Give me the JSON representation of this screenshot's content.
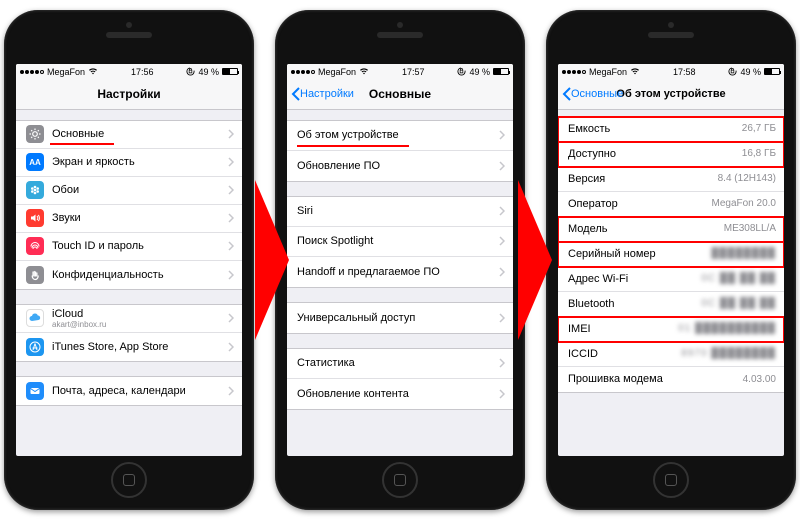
{
  "status": {
    "carrier": "MegaFon",
    "battery_pct": "49 %",
    "times": [
      "17:56",
      "17:57",
      "17:58"
    ]
  },
  "phone1": {
    "title": "Настройки",
    "rows_g1": [
      {
        "label": "Основные",
        "icon": "gear",
        "underline_w": 64
      },
      {
        "label": "Экран и яркость",
        "icon": "AA"
      },
      {
        "label": "Обои",
        "icon": "flower"
      },
      {
        "label": "Звуки",
        "icon": "speaker"
      },
      {
        "label": "Touch ID и пароль",
        "icon": "finger"
      },
      {
        "label": "Конфиденциальность",
        "icon": "hand"
      }
    ],
    "rows_g2": [
      {
        "label": "iCloud",
        "sub": "akart@inbox.ru",
        "icon": "cloud"
      },
      {
        "label": "iTunes Store, App Store",
        "icon": "appstore"
      }
    ],
    "rows_g3": [
      {
        "label": "Почта, адреса, календари",
        "icon": "mail"
      }
    ]
  },
  "phone2": {
    "back": "Настройки",
    "title": "Основные",
    "g1": [
      {
        "label": "Об этом устройстве",
        "underline_w": 112
      },
      {
        "label": "Обновление ПО"
      }
    ],
    "g2": [
      {
        "label": "Siri"
      },
      {
        "label": "Поиск Spotlight"
      },
      {
        "label": "Handoff и предлагаемое ПО"
      }
    ],
    "g3": [
      {
        "label": "Универсальный доступ"
      }
    ],
    "g4": [
      {
        "label": "Статистика"
      },
      {
        "label": "Обновление контента"
      }
    ]
  },
  "phone3": {
    "back": "Основные",
    "title": "Об этом устройстве",
    "rows": [
      {
        "label": "Емкость",
        "val": "26,7 ГБ",
        "red": true
      },
      {
        "label": "Доступно",
        "val": "16,8 ГБ",
        "red": true
      },
      {
        "label": "Версия",
        "val": "8.4 (12H143)"
      },
      {
        "label": "Оператор",
        "val": "MegaFon 20.0"
      },
      {
        "label": "Модель",
        "val": "ME308LL/A",
        "red": true
      },
      {
        "label": "Серийный номер",
        "val": "████████",
        "red": true,
        "blur": true
      },
      {
        "label": "Адрес Wi-Fi",
        "val": "0C ██ ██ ██",
        "blur": true
      },
      {
        "label": "Bluetooth",
        "val": "0C ██ ██ ██",
        "blur": true
      },
      {
        "label": "IMEI",
        "val": "01 ██████████",
        "red": true,
        "blur": true
      },
      {
        "label": "ICCID",
        "val": "8970 ████████",
        "blur": true
      },
      {
        "label": "Прошивка модема",
        "val": "4.03.00"
      }
    ]
  }
}
